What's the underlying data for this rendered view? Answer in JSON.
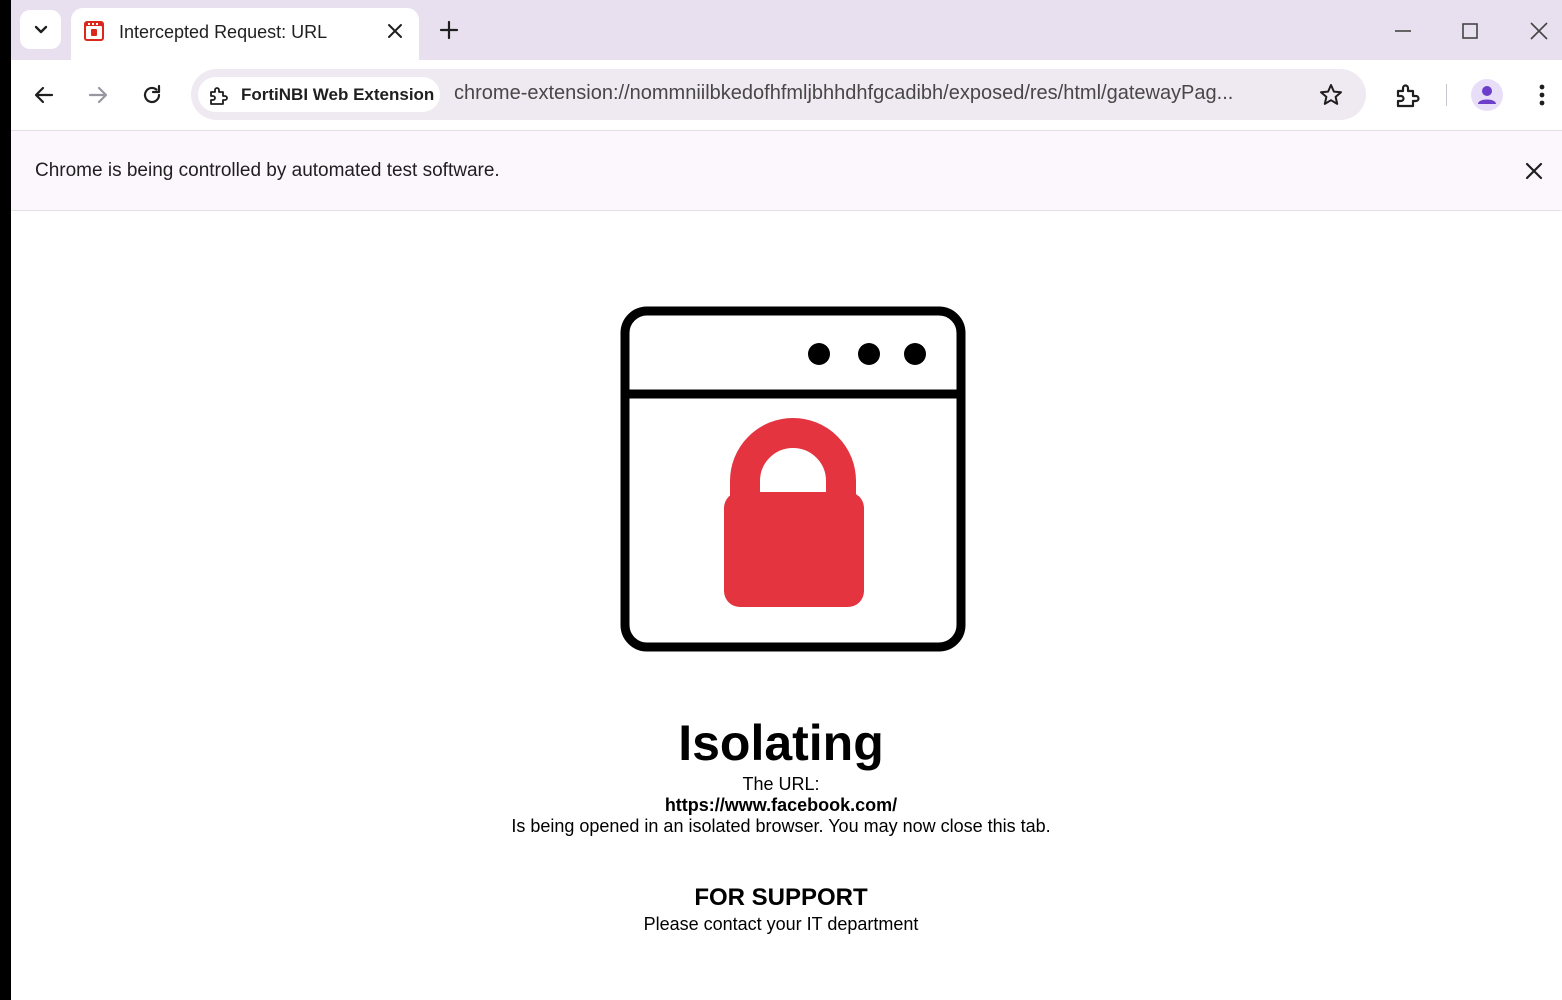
{
  "tab": {
    "title": "Intercepted Request: URL"
  },
  "toolbar": {
    "extension_chip_label": "FortiNBI Web Extension",
    "url": "chrome-extension://nommniilbkedofhfmljbhhdhfgcadibh/exposed/res/html/gatewayPag..."
  },
  "infobar": {
    "message": "Chrome is being controlled by automated test software."
  },
  "page": {
    "heading": "Isolating",
    "url_label": "The URL:",
    "intercepted_url": "https://www.facebook.com/",
    "status_message": "Is being opened in an isolated browser. You may now close this tab.",
    "support_heading": "FOR SUPPORT",
    "support_message": "Please contact your IT department"
  },
  "colors": {
    "lock": "#e33440",
    "tabstrip": "#e8e0ee",
    "omnibox": "#efe9f1",
    "infobar": "#fcf6fd",
    "avatar": "#6c3ec9"
  },
  "icons": {
    "tab_search": "chevron-down-icon",
    "favicon": "fortinet-icon",
    "tab_close": "close-icon",
    "new_tab": "plus-icon",
    "minimize": "minimize-icon",
    "maximize": "maximize-icon",
    "close_window": "close-icon",
    "back": "arrow-left-icon",
    "forward": "arrow-right-icon",
    "reload": "reload-icon",
    "extension": "puzzle-icon",
    "bookmark": "star-icon",
    "profile": "person-icon",
    "menu": "kebab-icon",
    "illustration": "browser-lock-icon"
  }
}
